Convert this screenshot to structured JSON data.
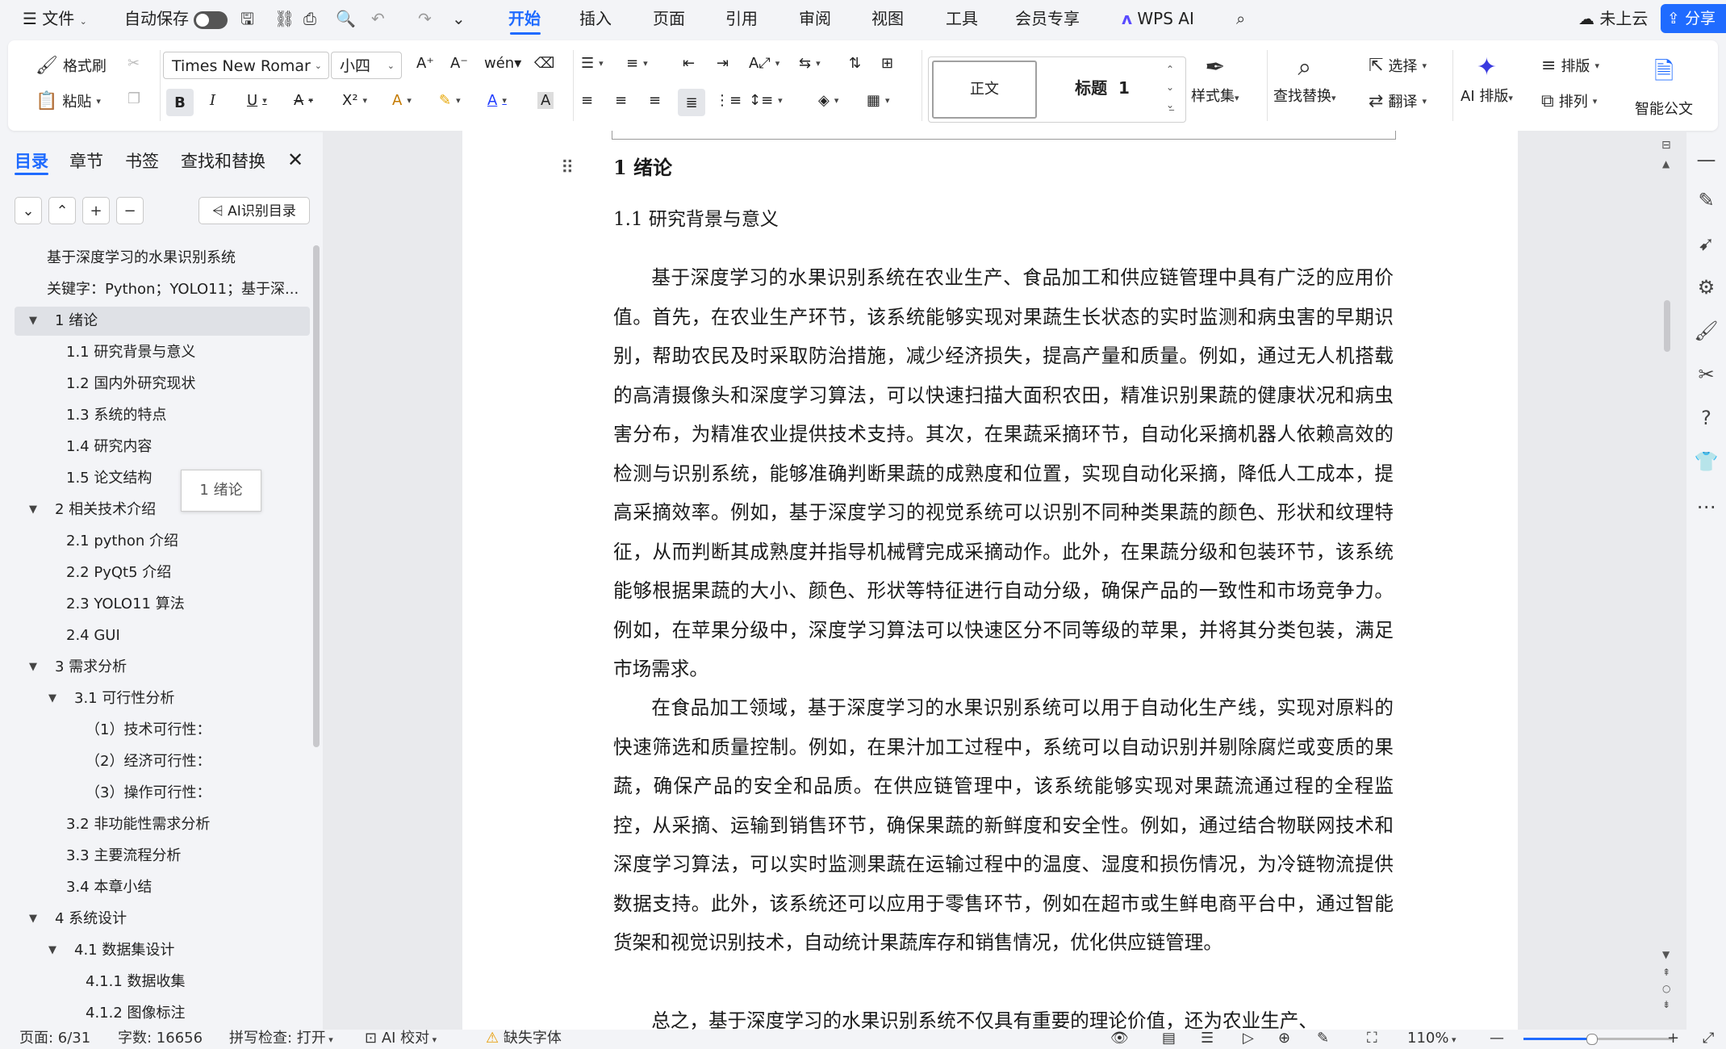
{
  "menubar": {
    "file": "文件",
    "autosave_label": "自动保存",
    "tabs": [
      "开始",
      "插入",
      "页面",
      "引用",
      "审阅",
      "视图",
      "工具",
      "会员专享",
      "WPS AI"
    ],
    "cloud": "未上云",
    "share": "分享"
  },
  "ribbon": {
    "format_painter": "格式刷",
    "paste": "粘贴",
    "font_name": "Times New Romar",
    "font_size": "小四",
    "style_normal": "正文",
    "style_heading1": "标题  1",
    "style_set": "样式集",
    "find_replace": "查找替换",
    "select": "选择",
    "translate": "翻译",
    "ai_layout": "AI 排版",
    "layout": "排版",
    "arrange": "排列",
    "smart_doc": "智能公文"
  },
  "panel": {
    "tabs": [
      "目录",
      "章节",
      "书签",
      "查找和替换"
    ],
    "ai_toc": "AI识别目录",
    "tooltip": "1 绪论",
    "toc": [
      {
        "text": "基于深度学习的水果识别系统",
        "level": 0,
        "tri": ""
      },
      {
        "text": "关键字：Python；YOLO11；基于深...",
        "level": 0,
        "tri": ""
      },
      {
        "text": "1  绪论",
        "level": 0,
        "tri": "▼",
        "selected": true
      },
      {
        "text": "1.1 研究背景与意义",
        "level": 1,
        "tri": ""
      },
      {
        "text": "1.2 国内外研究现状",
        "level": 1,
        "tri": ""
      },
      {
        "text": "1.3 系统的特点",
        "level": 1,
        "tri": ""
      },
      {
        "text": "1.4 研究内容",
        "level": 1,
        "tri": ""
      },
      {
        "text": "1.5 论文结构",
        "level": 1,
        "tri": ""
      },
      {
        "text": "2  相关技术介绍",
        "level": 0,
        "tri": "▼"
      },
      {
        "text": "2.1 python 介绍",
        "level": 1,
        "tri": ""
      },
      {
        "text": "2.2 PyQt5 介绍",
        "level": 1,
        "tri": ""
      },
      {
        "text": "2.3 YOLO11 算法",
        "level": 1,
        "tri": ""
      },
      {
        "text": "2.4 GUI",
        "level": 1,
        "tri": ""
      },
      {
        "text": "3  需求分析",
        "level": 0,
        "tri": "▼"
      },
      {
        "text": "3.1 可行性分析",
        "level": 1,
        "tri": "▼"
      },
      {
        "text": "（1）技术可行性：",
        "level": 2,
        "tri": ""
      },
      {
        "text": "（2）经济可行性：",
        "level": 2,
        "tri": ""
      },
      {
        "text": "（3）操作可行性：",
        "level": 2,
        "tri": ""
      },
      {
        "text": "3.2  非功能性需求分析",
        "level": 1,
        "tri": ""
      },
      {
        "text": "3.3 主要流程分析",
        "level": 1,
        "tri": ""
      },
      {
        "text": "3.4 本章小结",
        "level": 1,
        "tri": ""
      },
      {
        "text": "4  系统设计",
        "level": 0,
        "tri": "▼"
      },
      {
        "text": "4.1  数据集设计",
        "level": 1,
        "tri": "▼"
      },
      {
        "text": "4.1.1 数据收集",
        "level": 2,
        "tri": ""
      },
      {
        "text": "4.1.2 图像标注",
        "level": 2,
        "tri": ""
      }
    ]
  },
  "document": {
    "h1": "1  绪论",
    "h2": "1.1 研究背景与意义",
    "paragraphs": [
      "基于深度学习的水果识别系统在农业生产、食品加工和供应链管理中具有广泛的应用价值。首先，在农业生产环节，该系统能够实现对果蔬生长状态的实时监测和病虫害的早期识别，帮助农民及时采取防治措施，减少经济损失，提高产量和质量。例如，通过无人机搭载的高清摄像头和深度学习算法，可以快速扫描大面积农田，精准识别果蔬的健康状况和病虫害分布，为精准农业提供技术支持。其次，在果蔬采摘环节，自动化采摘机器人依赖高效的检测与识别系统，能够准确判断果蔬的成熟度和位置，实现自动化采摘，降低人工成本，提高采摘效率。例如，基于深度学习的视觉系统可以识别不同种类果蔬的颜色、形状和纹理特征，从而判断其成熟度并指导机械臂完成采摘动作。此外，在果蔬分级和包装环节，该系统能够根据果蔬的大小、颜色、形状等特征进行自动分级，确保产品的一致性和市场竞争力。例如，在苹果分级中，深度学习算法可以快速区分不同等级的苹果，并将其分类包装，满足市场需求。",
      "在食品加工领域，基于深度学习的水果识别系统可以用于自动化生产线，实现对原料的快速筛选和质量控制。例如，在果汁加工过程中，系统可以自动识别并剔除腐烂或变质的果蔬，确保产品的安全和品质。在供应链管理中，该系统能够实现对果蔬流通过程的全程监控，从采摘、运输到销售环节，确保果蔬的新鲜度和安全性。例如，通过结合物联网技术和深度学习算法，可以实时监测果蔬在运输过程中的温度、湿度和损伤情况，为冷链物流提供数据支持。此外，该系统还可以应用于零售环节，例如在超市或生鲜电商平台中，通过智能货架和视觉识别技术，自动统计果蔬库存和销售情况，优化供应链管理。",
      "总之，基于深度学习的水果识别系统不仅具有重要的理论价值，还为农业生产、"
    ]
  },
  "status": {
    "page": "页面: 6/31",
    "words": "字数: 16656",
    "spell": "拼写检查: 打开",
    "ai_proof": "AI 校对",
    "missing_font": "缺失字体",
    "zoom": "110%"
  },
  "colors": {
    "accent": "#1f6bff",
    "selected_row": "#dfe1e6"
  }
}
